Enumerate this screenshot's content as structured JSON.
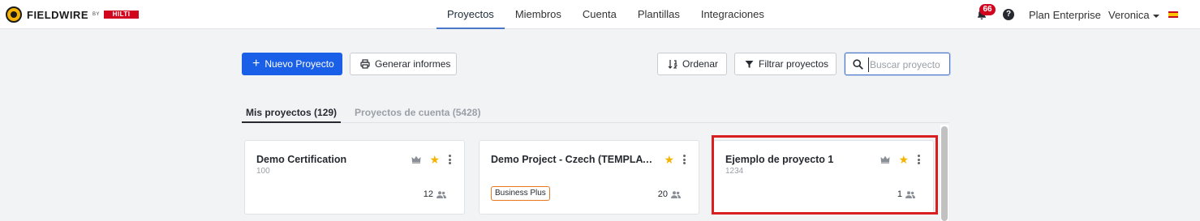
{
  "brand": {
    "name": "FIELDWIRE",
    "by": "BY",
    "partner": "HILTI"
  },
  "nav": {
    "items": [
      {
        "label": "Proyectos",
        "active": true
      },
      {
        "label": "Miembros",
        "active": false
      },
      {
        "label": "Cuenta",
        "active": false
      },
      {
        "label": "Plantillas",
        "active": false
      },
      {
        "label": "Integraciones",
        "active": false
      }
    ]
  },
  "header_right": {
    "notification_count": "66",
    "help": "?",
    "plan": "Plan Enterprise",
    "user": "Veronica",
    "language_flag": "spain-flag-icon"
  },
  "toolbar": {
    "new_project": "Nuevo Proyecto",
    "generate_reports": "Generar informes",
    "sort": "Ordenar",
    "filter": "Filtrar proyectos",
    "search_placeholder": "Buscar proyecto",
    "search_value": ""
  },
  "tabs": [
    {
      "label": "Mis proyectos (129)",
      "active": true
    },
    {
      "label": "Proyectos de cuenta (5428)",
      "active": false
    }
  ],
  "projects": [
    {
      "title": "Demo Certification",
      "code": "100",
      "members": "12",
      "starred": true,
      "plan_badge": ""
    },
    {
      "title": "Demo Project - Czech (TEMPLATE - ...",
      "code": "",
      "members": "20",
      "starred": true,
      "plan_badge": "Business Plus"
    },
    {
      "title": "Ejemplo de proyecto 1",
      "code": "1234",
      "members": "1",
      "starred": true,
      "plan_badge": ""
    }
  ],
  "colors": {
    "primary": "#1a5fe8",
    "accent_nav": "#4a77c9",
    "star": "#f5b301",
    "highlight": "#d81e1e",
    "badge_border": "#e87722",
    "notification": "#d2051e"
  }
}
